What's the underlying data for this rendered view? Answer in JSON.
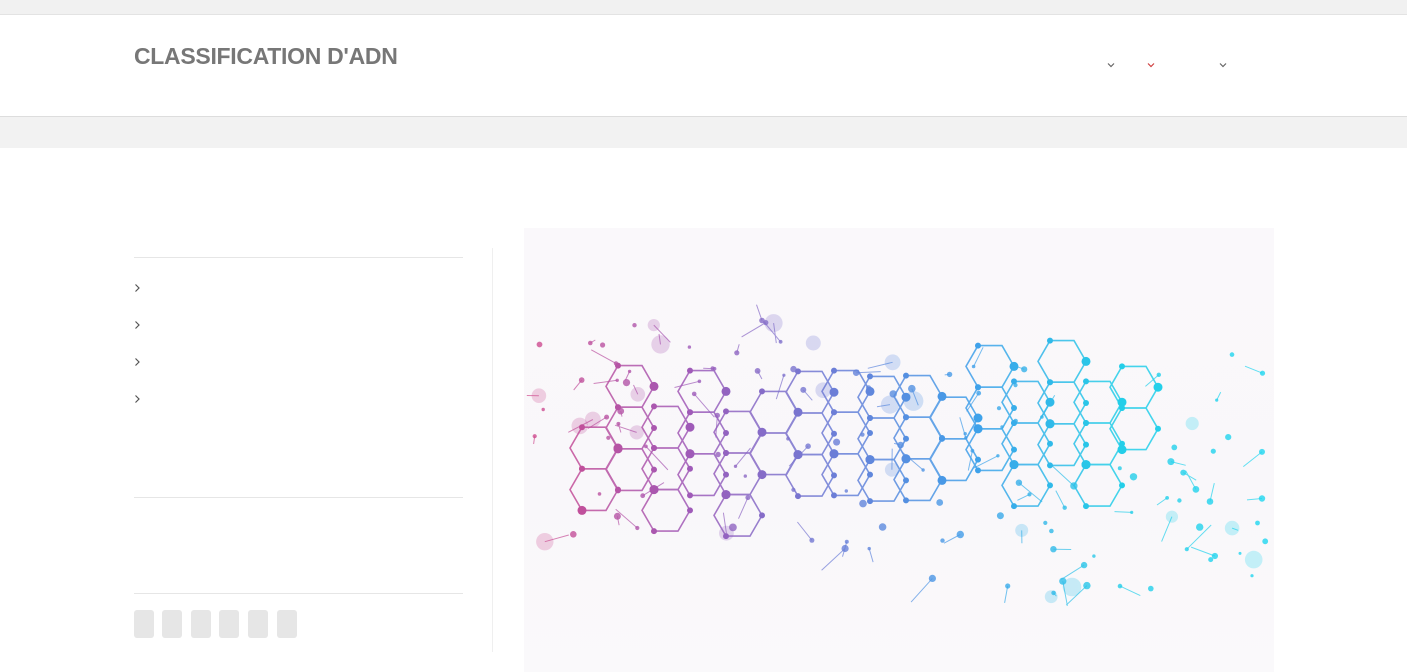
{
  "header": {
    "site_title": "CLASSIFICATION D'ADN",
    "nav_menus": [
      {
        "icon": "chevron-down-icon",
        "color": "#666666"
      },
      {
        "icon": "chevron-down-icon",
        "color": "#d04040"
      },
      {
        "icon": "chevron-down-icon",
        "color": "#666666"
      }
    ]
  },
  "sidebar": {
    "items": [
      {
        "icon": "chevron-right-icon"
      },
      {
        "icon": "chevron-right-icon"
      },
      {
        "icon": "chevron-right-icon"
      },
      {
        "icon": "chevron-right-icon"
      }
    ],
    "share_buttons": 6
  },
  "hero": {
    "image": "dna-molecule-network-illustration",
    "colors": [
      "#c2307a",
      "#8a5cc4",
      "#4a7fe0",
      "#1ed0f0"
    ]
  }
}
